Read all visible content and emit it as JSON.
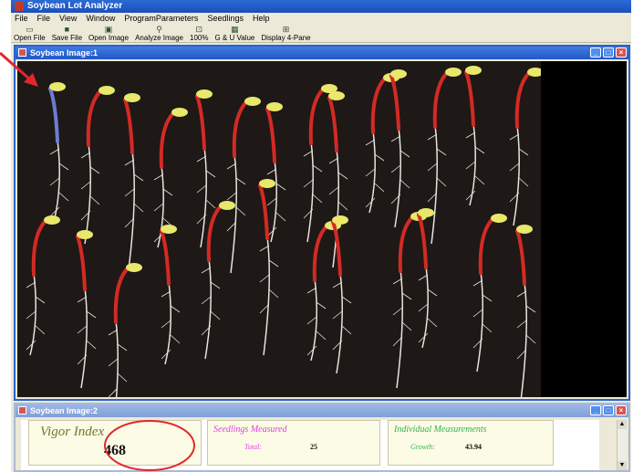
{
  "app": {
    "title": "Soybean Lot Analyzer"
  },
  "menu": [
    "File",
    "File",
    "View",
    "Window",
    "ProgramParameters",
    "Seedlings",
    "Help"
  ],
  "toolbar": [
    {
      "label": "Open File",
      "icon": "folder-icon"
    },
    {
      "label": "Save File",
      "icon": "disk-icon"
    },
    {
      "label": "Open Image",
      "icon": "image-icon"
    },
    {
      "label": "Analyze Image",
      "icon": "magnifier-icon"
    },
    {
      "label": "100%",
      "icon": "zoom-icon"
    },
    {
      "label": "G & U Value",
      "icon": "grid-icon"
    },
    {
      "label": "Display 4-Pane",
      "icon": "four-pane-icon"
    }
  ],
  "window1": {
    "title": "Soybean Image:1"
  },
  "window2": {
    "title": "Soybean Image:2"
  },
  "results": {
    "vigor_title": "Vigor Index",
    "vigor_value": "468",
    "seedlings_title": "Seedlings Measured",
    "total_label": "Total:",
    "total_value": "25",
    "individual_title": "Individual Measurements",
    "growth_label": "Growth:",
    "growth_value": "43.94"
  },
  "colors": {
    "titlebar": "#1c4fb8",
    "annotation": "#e0282c",
    "hypocotyl": "#d32a24",
    "cotyledon": "#e8e86a",
    "root": "#e9e5dc",
    "vigor_title": "#6c7a2a",
    "seedlings_title": "#e040e0",
    "individual_title": "#35b24a"
  }
}
